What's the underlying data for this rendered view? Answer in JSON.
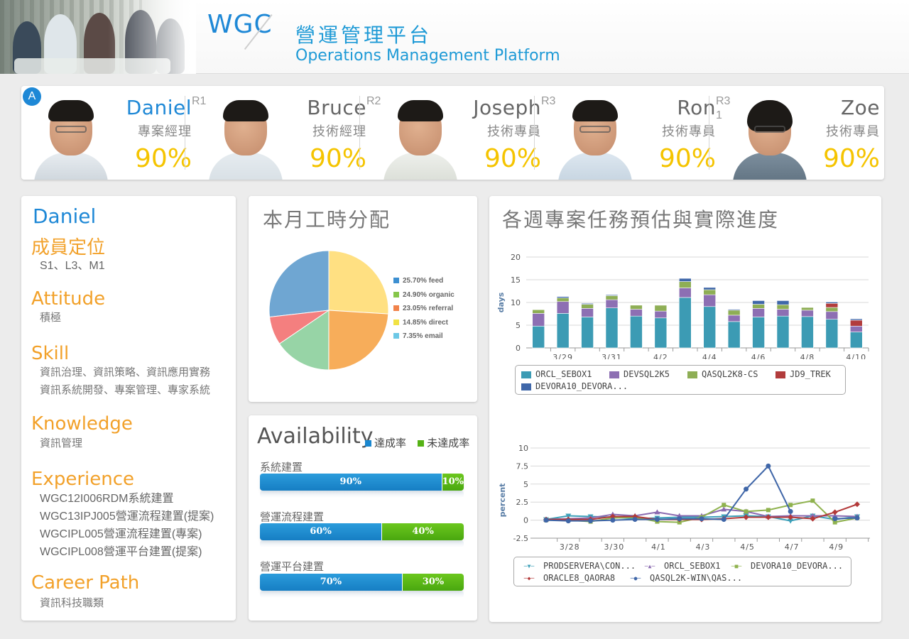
{
  "header": {
    "brand": "WGC",
    "title_zh": "營運管理平台",
    "title_en": "Operations Management Platform"
  },
  "team": [
    {
      "rank": "A",
      "name": "Daniel",
      "role": "專案經理",
      "pct": "90%"
    },
    {
      "rank": "R1",
      "name": "Bruce",
      "role": "技術經理",
      "pct": "90%"
    },
    {
      "rank": "R2",
      "name": "Joseph",
      "role": "技術專員",
      "pct": "90%"
    },
    {
      "rank": "R3",
      "name": "Ron",
      "role": "技術專員",
      "pct": "90%"
    },
    {
      "rank": "R3\n1",
      "name": "Zoe",
      "role": "技術專員",
      "pct": "90%"
    }
  ],
  "profile": {
    "name": "Daniel",
    "position_h": "成員定位",
    "position_v": "S1、L3、M1",
    "attitude_h": "Attitude",
    "attitude_v": "積極",
    "skill_h": "Skill",
    "skill_v": [
      "資訊治理、資訊策略、資訊應用實務",
      "資訊系統開發、專案管理、專家系統"
    ],
    "knowledge_h": "Knowledge",
    "knowledge_v": "資訊管理",
    "experience_h": "Experience",
    "experience_v": [
      "WGC12I006RDM系統建置",
      "WGC13IPJ005營運流程建置(提案)",
      "WGCIPL005營運流程建置(專案)",
      "WGCIPL008營運平台建置(提案)"
    ],
    "career_h": "Career Path",
    "career_v": "資訊科技職類"
  },
  "availability": {
    "title": "Availability",
    "legend": [
      "達成率",
      "未達成率"
    ],
    "rows": [
      {
        "label": "系統建置",
        "a": 90,
        "b": 10,
        "a_text": "90%",
        "b_text": "10%"
      },
      {
        "label": "營運流程建置",
        "a": 60,
        "b": 40,
        "a_text": "60%",
        "b_text": "40%"
      },
      {
        "label": "營運平台建置",
        "a": 70,
        "b": 30,
        "a_text": "70%",
        "b_text": "30%"
      }
    ]
  },
  "weekly": {
    "title": "各週專案任務預估與實際進度"
  },
  "chart_data": [
    {
      "type": "pie",
      "title": "本月工時分配",
      "slices": [
        {
          "label": "25.70% feed",
          "value": 25.7,
          "color": "#6fa6d2"
        },
        {
          "label": "24.90% organic",
          "value": 24.9,
          "color": "#ffe082"
        },
        {
          "label": "23.05% referral",
          "value": 23.05,
          "color": "#f7ad5a"
        },
        {
          "label": "14.85% direct",
          "value": 14.85,
          "color": "#97d4a6"
        },
        {
          "label": "7.35% email",
          "value": 7.35,
          "color": "#f47f7f"
        }
      ],
      "legend_colors": [
        "#3c8fd1",
        "#86c64a",
        "#f1824a",
        "#f1e244",
        "#6cc8e6"
      ]
    },
    {
      "type": "bar",
      "stacked": true,
      "ylabel": "days",
      "ylim": [
        0,
        20
      ],
      "yticks": [
        0,
        5,
        10,
        15,
        20
      ],
      "xticks": [
        "3/29",
        "3/31",
        "4/2",
        "4/4",
        "4/6",
        "4/8",
        "4/10"
      ],
      "categories": [
        "3/28",
        "3/29",
        "3/30",
        "3/31",
        "4/1",
        "4/2",
        "4/3",
        "4/4",
        "4/5",
        "4/6",
        "4/7",
        "4/8",
        "4/9",
        "4/10"
      ],
      "series": [
        {
          "name": "ORCL_SEBOX1",
          "color": "#3c9bb4",
          "values": [
            4.8,
            7.6,
            6.8,
            8.8,
            7.0,
            6.6,
            11.1,
            9.1,
            5.8,
            6.8,
            7.0,
            6.9,
            6.3,
            3.5
          ]
        },
        {
          "name": "DEVSQL2K5",
          "color": "#8d6fb3",
          "values": [
            2.8,
            2.6,
            1.9,
            1.8,
            1.5,
            1.5,
            2.1,
            2.6,
            1.4,
            1.9,
            1.5,
            1.4,
            1.7,
            1.3
          ]
        },
        {
          "name": "QASQL2K8-CS",
          "color": "#8eae55",
          "values": [
            0.8,
            0.8,
            0.9,
            0.9,
            0.9,
            1.3,
            1.4,
            1.1,
            1.1,
            0.9,
            1.0,
            0.6,
            0.9,
            0
          ]
        },
        {
          "name": "JD9_TREK",
          "color": "#b23c3c",
          "values": [
            0,
            0,
            0,
            0,
            0,
            0,
            0,
            0,
            0,
            0,
            0,
            0,
            0.9,
            1.3
          ]
        },
        {
          "name": "DEVORA10_DEVORA...",
          "color": "#3f67a9",
          "values": [
            0,
            0.3,
            0.2,
            0.2,
            0,
            0.1,
            0.7,
            0.5,
            0.2,
            0.8,
            0.9,
            0,
            0.3,
            0.3
          ]
        }
      ]
    },
    {
      "type": "line",
      "ylabel": "percent",
      "ylim": [
        -2.5,
        10
      ],
      "yticks": [
        -2.5,
        0,
        2.5,
        5,
        7.5,
        10
      ],
      "xticks": [
        "3/28",
        "3/30",
        "4/1",
        "4/3",
        "4/5",
        "4/7",
        "4/9"
      ],
      "x": [
        "3/27",
        "3/28",
        "3/29",
        "3/30",
        "3/31",
        "4/1",
        "4/2",
        "4/3",
        "4/4",
        "4/5",
        "4/6",
        "4/7",
        "4/8",
        "4/9",
        "4/10"
      ],
      "series": [
        {
          "name": "PRODSERVERA\\CON...",
          "color": "#3ca0b9",
          "marker": "triangle-down",
          "values": [
            0.1,
            0.6,
            0.5,
            0.4,
            0.2,
            0.3,
            0.4,
            0.4,
            0.5,
            0.6,
            0.5,
            -0.1,
            0.6,
            0.1,
            0.5
          ]
        },
        {
          "name": "ORCL_SEBOX1",
          "color": "#8a6ab0",
          "marker": "triangle-up",
          "values": [
            0.1,
            0.2,
            0.3,
            0.8,
            0.6,
            1.1,
            0.6,
            0.6,
            1.5,
            1.2,
            0.5,
            0.6,
            0.6,
            0.6,
            0.5
          ]
        },
        {
          "name": "DEVORA10_DEVORA...",
          "color": "#8fb24e",
          "marker": "square",
          "values": [
            0,
            0,
            -0.2,
            0.3,
            0.4,
            -0.2,
            -0.3,
            0.4,
            2.1,
            1.2,
            1.4,
            2.1,
            2.7,
            -0.3,
            0.3
          ]
        },
        {
          "name": "ORACLE8_QAORA8",
          "color": "#b33939",
          "marker": "diamond",
          "values": [
            0.1,
            0.1,
            0.1,
            0.5,
            0.5,
            0.1,
            0.1,
            0.1,
            0.2,
            0.4,
            0.4,
            0.4,
            0.2,
            1.1,
            2.2
          ]
        },
        {
          "name": "QASQL2K-WIN\\QAS...",
          "color": "#3f66a8",
          "marker": "circle",
          "values": [
            0,
            -0.1,
            -0.1,
            0,
            0.1,
            0.1,
            0.2,
            0.2,
            0.1,
            4.3,
            7.5,
            1.2,
            null,
            0.2,
            0.3
          ]
        }
      ]
    }
  ]
}
